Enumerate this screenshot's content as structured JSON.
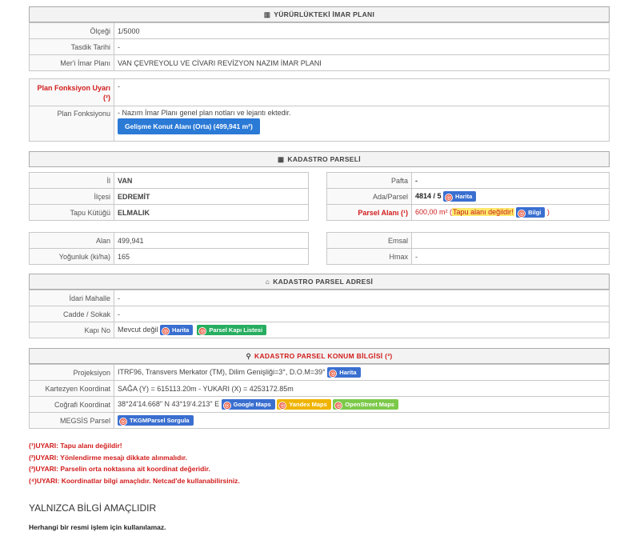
{
  "imar": {
    "header": "YÜRÜRLÜKTEKİ İMAR PLANI",
    "rows": [
      {
        "label": "Ölçeği",
        "value": "1/5000"
      },
      {
        "label": "Tasdik Tarihi",
        "value": "-"
      },
      {
        "label": "Mer'i İmar Planı",
        "value": "VAN ÇEVREYOLU VE CİVARI REVİZYON NAZIM İMAR PLANI"
      }
    ]
  },
  "fonksiyon": {
    "uyari_label": "Plan Fonksiyon Uyarı (²)",
    "uyari_value": "-",
    "label": "Plan Fonksiyonu",
    "note": "- Nazım İmar Planı genel plan notları ve lejantı ektedir.",
    "button": "Gelişme Konut Alanı (Orta) (499,941 m²)"
  },
  "kadastro": {
    "header": "KADASTRO PARSELİ",
    "left": [
      {
        "label": "İl",
        "value": "VAN"
      },
      {
        "label": "İlçesi",
        "value": "EDREMİT"
      },
      {
        "label": "Tapu Kütüğü",
        "value": "ELMALIK"
      }
    ],
    "pafta_label": "Pafta",
    "pafta_value": "-",
    "ada_label": "Ada/Parsel",
    "ada_value": "4814 / 5",
    "ada_btn": "Harita",
    "alan_label": "Parsel Alanı (¹)",
    "alan_value": "600,00 m²",
    "alan_warn": "Tapu alanı değildir!",
    "alan_btn": "Bilgi",
    "alan_close": ")",
    "alan2_label": "Alan",
    "alan2_value": "499,941",
    "yog_label": "Yoğunluk (ki/ha)",
    "yog_value": "165",
    "emsal_label": "Emsal",
    "emsal_value": "",
    "hmax_label": "Hmax",
    "hmax_value": "-"
  },
  "adres": {
    "header": "KADASTRO PARSEL ADRESİ",
    "mahalle_label": "İdari Mahalle",
    "mahalle_value": "-",
    "cadde_label": "Cadde / Sokak",
    "cadde_value": "-",
    "kapi_label": "Kapı No",
    "kapi_value": "Mevcut değil",
    "kapi_btn1": "Harita",
    "kapi_btn2": "Parsel Kapı Listesi"
  },
  "konum": {
    "header": "KADASTRO PARSEL KONUM BİLGİSİ (³)",
    "proj_label": "Projeksiyon",
    "proj_value": "ITRF96, Transvers Merkator (TM), Dilim Genişliği=3°, D.O.M=39°",
    "proj_btn": "Harita",
    "kart_label": "Kartezyen Koordinat",
    "kart_value": "SAĞA (Y) = 615113.20m - YUKARI (X) = 4253172.85m",
    "cog_label": "Coğrafi Koordinat",
    "cog_value": "38°24'14.668\" N 43°19'4.213\" E",
    "cog_btn1": "Google Maps",
    "cog_btn2": "Yandex Maps",
    "cog_btn3": "OpenStreet Maps",
    "megsis_label": "MEGSİS Parsel",
    "megsis_btn": "TKGMParsel Sorgula"
  },
  "warnings": [
    "(¹)UYARI: Tapu alanı değildir!",
    "(²)UYARI: Yönlendirme mesajı dikkate alınmalıdır.",
    "(³)UYARI: Parselin orta noktasına ait koordinat değeridir.",
    "(⁴)UYARI: Koordinatlar bilgi amaçlıdır. Netcad'de kullanabilirsiniz."
  ],
  "footer": {
    "title": "YALNIZCA BİLGİ AMAÇLIDIR",
    "note": "Herhangi bir resmi işlem için kullanılamaz."
  }
}
